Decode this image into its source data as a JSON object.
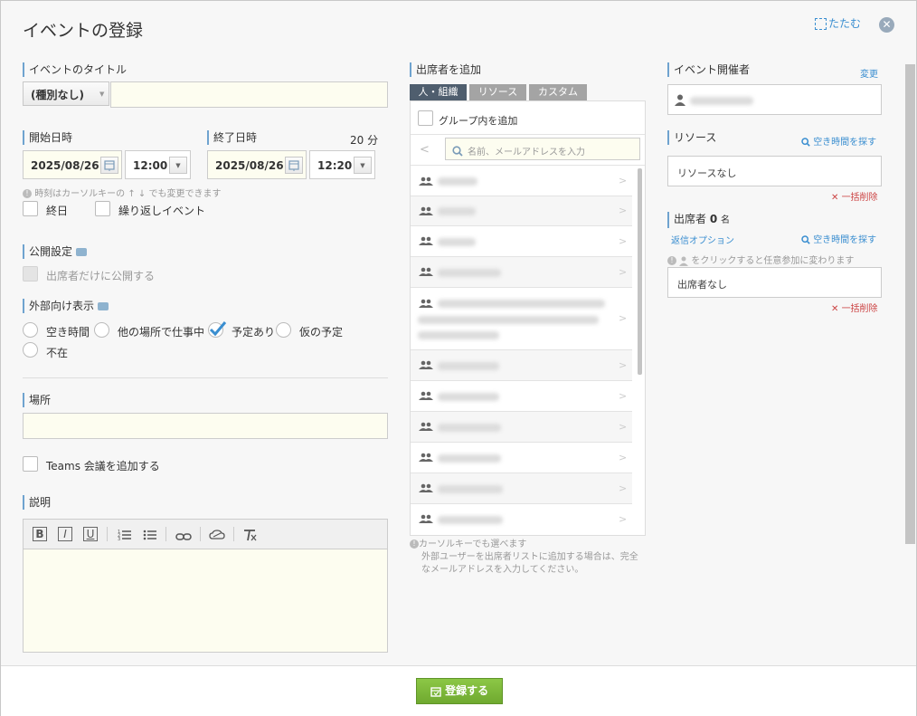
{
  "dialog": {
    "title": "イベントの登録",
    "collapse_label": "たたむ",
    "close_symbol": "✕"
  },
  "left": {
    "title_section": {
      "label": "イベントのタイトル",
      "type_value": "(種別なし)",
      "title_value": ""
    },
    "start": {
      "label": "開始日時",
      "date": "2025/08/26",
      "time": "12:00"
    },
    "end": {
      "label": "終了日時",
      "date": "2025/08/26",
      "time": "12:20",
      "duration": "20 分"
    },
    "time_hint": "時刻はカーソルキーの ↑ ↓ でも変更できます",
    "allday_label": "終日",
    "repeat_label": "繰り返しイベント",
    "publish": {
      "label": "公開設定",
      "attendees_only": "出席者だけに公開する"
    },
    "external": {
      "label": "外部向け表示",
      "options": [
        "空き時間",
        "他の場所で仕事中",
        "予定あり",
        "仮の予定",
        "不在"
      ],
      "selected": "予定あり"
    },
    "location": {
      "label": "場所",
      "value": ""
    },
    "teams_label": "Teams 会議を追加する",
    "description": {
      "label": "説明",
      "toolbar": {
        "bold": "B",
        "italic": "I",
        "underline": "U"
      },
      "value": ""
    }
  },
  "middle": {
    "label": "出席者を追加",
    "tabs": [
      "人・組織",
      "リソース",
      "カスタム"
    ],
    "active_tab": "人・組織",
    "group_add_label": "グループ内を追加",
    "search_placeholder": "名前、メールアドレスを入力",
    "hint_line1": "カーソルキーでも選べます",
    "hint_line2": "外部ユーザーを出席者リストに追加する場合は、完全",
    "hint_line3": "なメールアドレスを入力してください。"
  },
  "right": {
    "organizer": {
      "label": "イベント開催者",
      "change_label": "変更"
    },
    "resource": {
      "label": "リソース",
      "find_label": "空き時間を探す",
      "empty": "リソースなし",
      "delete_all": "一括削除"
    },
    "attendees": {
      "label": "出席者",
      "count": "0",
      "unit": "名",
      "reply_option": "返信オプション",
      "find_label": "空き時間を探す",
      "hint": "をクリックすると任意参加に変わります",
      "empty": "出席者なし",
      "delete_all": "一括削除"
    }
  },
  "footer": {
    "register_label": "登録する"
  },
  "colors": {
    "accent_blue": "#3a8ed0",
    "tab_active": "#4f5e6e",
    "tab_inactive": "#a4a4a4",
    "register_green": "#7db83a",
    "danger_red": "#cc4444"
  },
  "icons": [
    "close-icon",
    "collapse-icon",
    "calendar-icon",
    "chevron-down-icon",
    "person-icon",
    "group-icon",
    "search-icon",
    "info-icon",
    "comment-icon",
    "checkmark-icon",
    "register-icon"
  ]
}
